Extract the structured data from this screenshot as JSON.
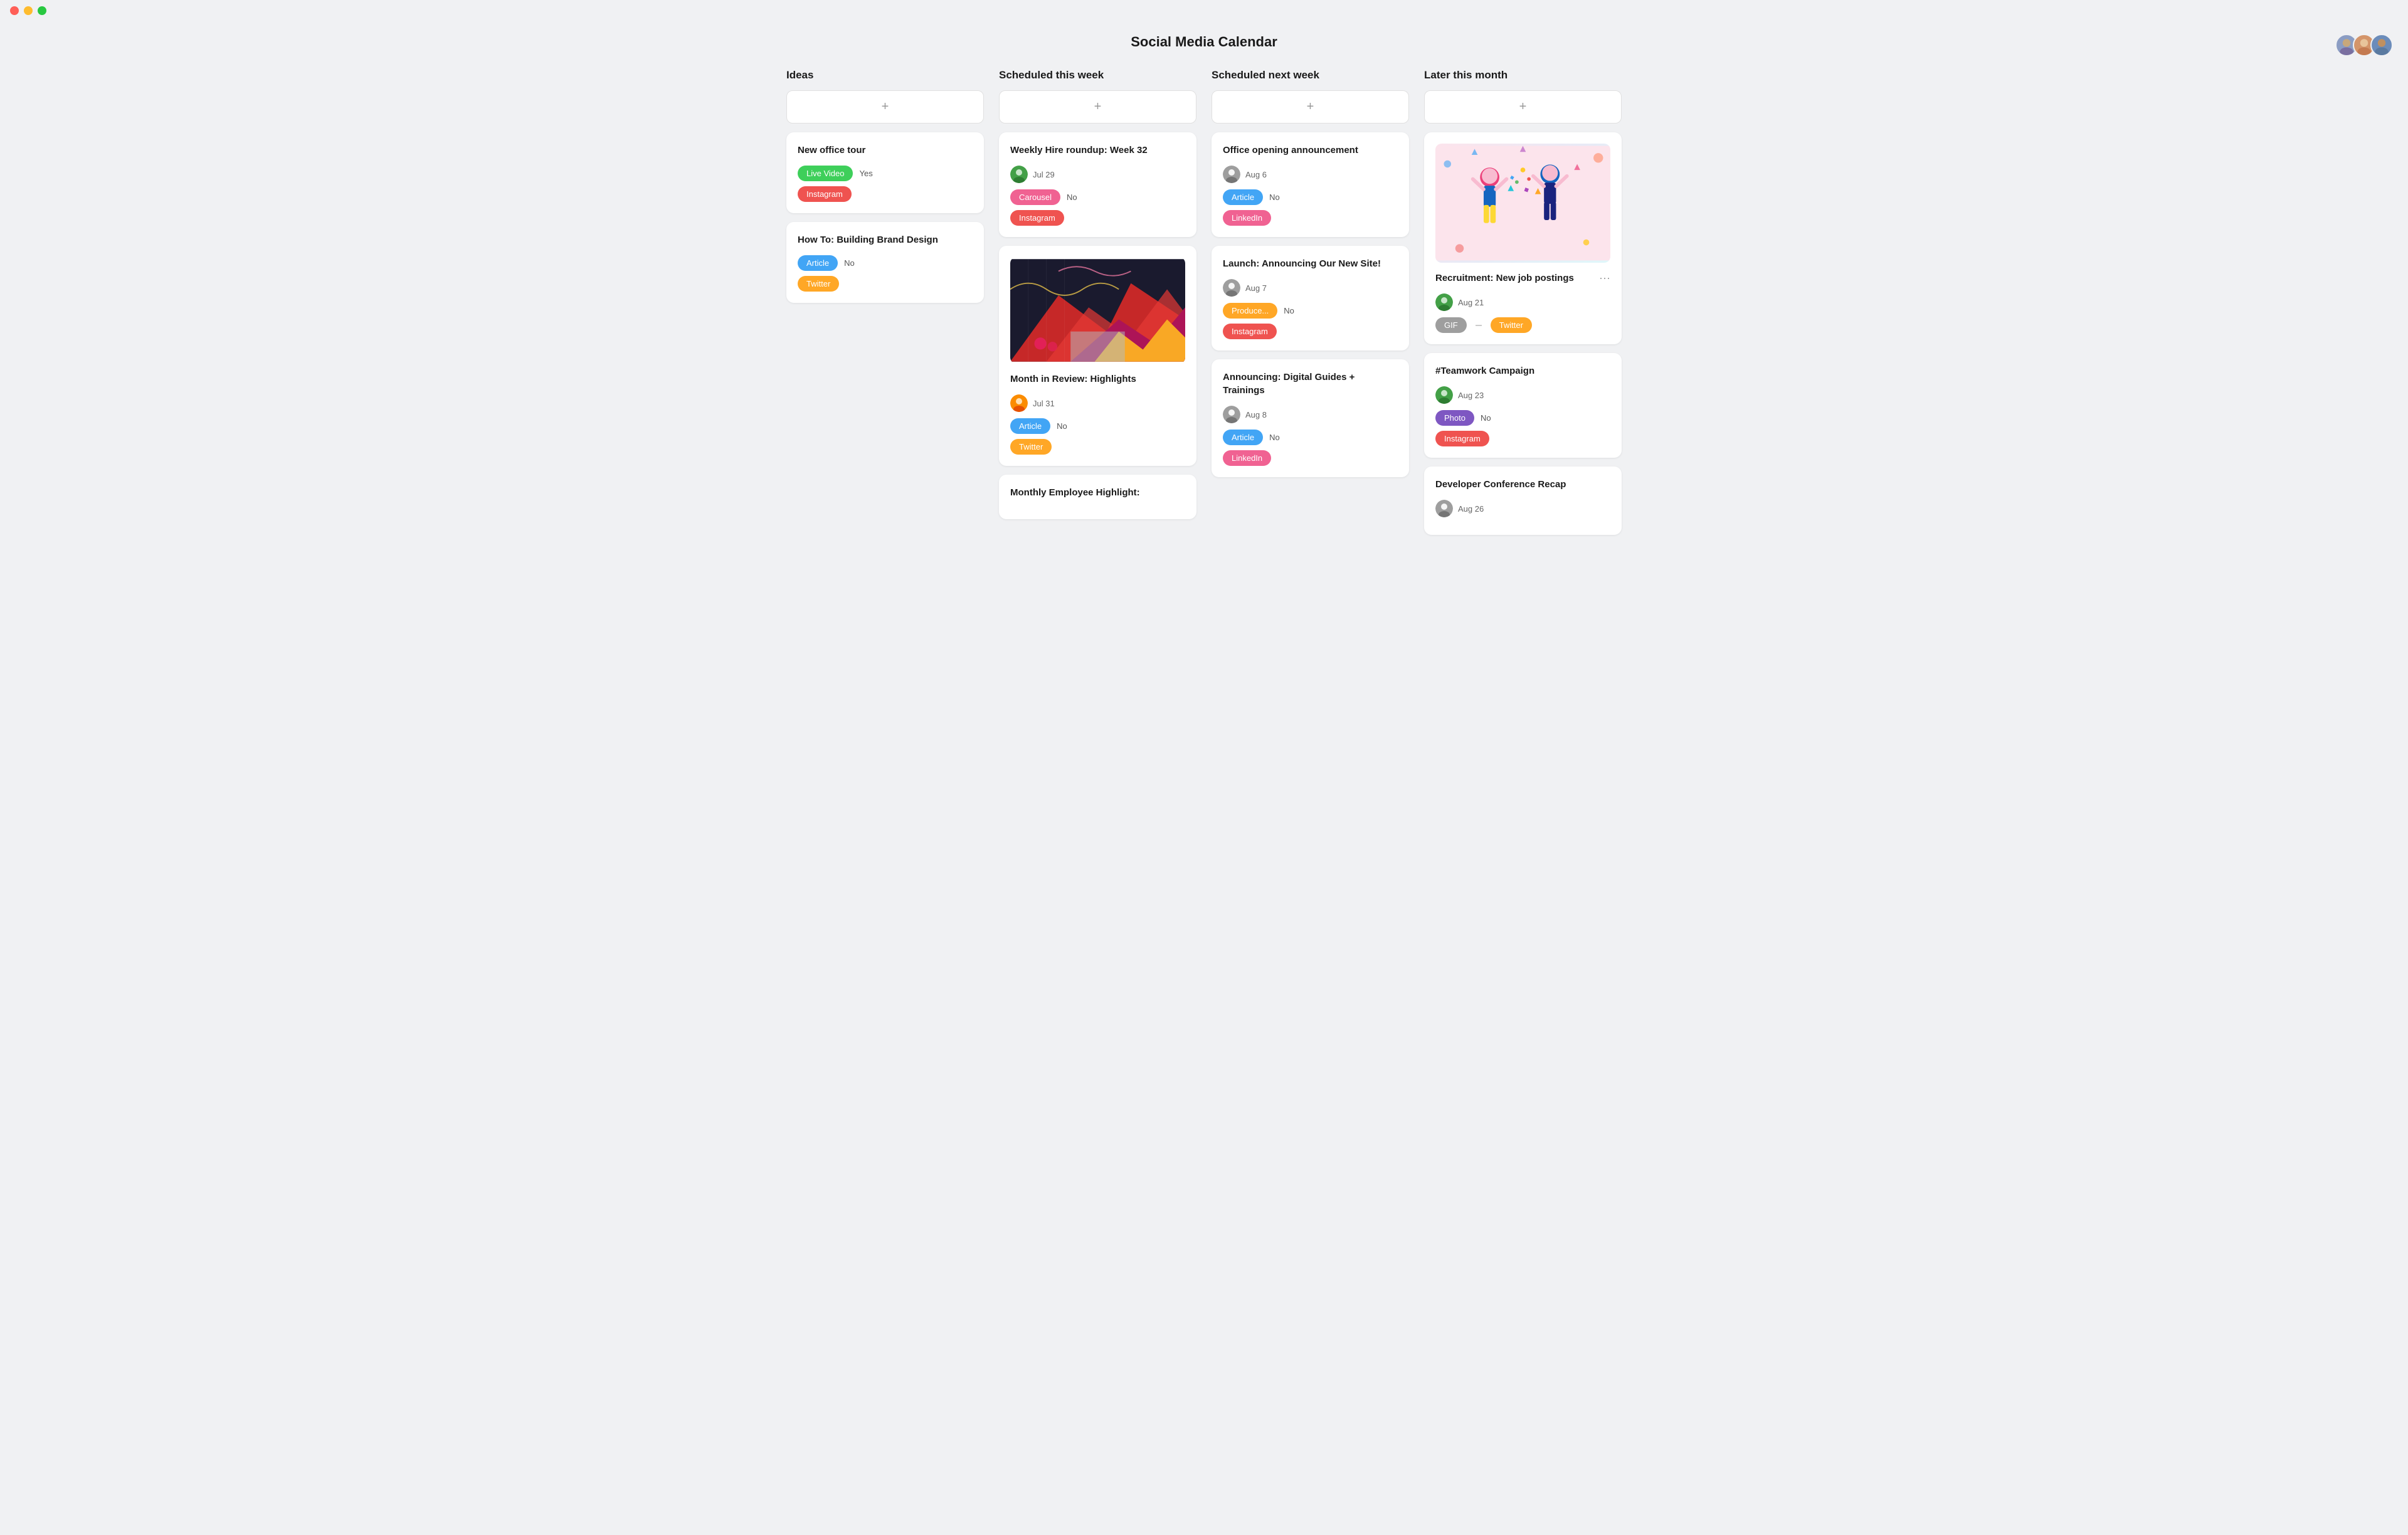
{
  "app": {
    "title": "Social Media Calendar"
  },
  "avatars": [
    {
      "id": "avatar-1",
      "color": "#8b9dc3",
      "emoji": "👩"
    },
    {
      "id": "avatar-2",
      "color": "#c4845a",
      "emoji": "👩"
    },
    {
      "id": "avatar-3",
      "color": "#6b8cba",
      "emoji": "👨"
    }
  ],
  "columns": [
    {
      "id": "ideas",
      "header": "Ideas",
      "add_label": "+",
      "cards": [
        {
          "id": "card-new-office",
          "title": "New office tour",
          "tags": [
            {
              "label": "Live Video",
              "color": "tag-green"
            },
            {
              "label": "Instagram",
              "color": "tag-red"
            }
          ],
          "value_label": "Yes",
          "show_value": true
        },
        {
          "id": "card-brand-design",
          "title": "How To: Building Brand Design",
          "tags": [
            {
              "label": "Article",
              "color": "tag-blue"
            },
            {
              "label": "Twitter",
              "color": "tag-orange"
            }
          ],
          "value_label": "No",
          "show_value": true
        }
      ]
    },
    {
      "id": "scheduled-this-week",
      "header": "Scheduled this week",
      "add_label": "+",
      "cards": [
        {
          "id": "card-weekly-hire",
          "title": "Weekly Hire roundup: Week 32",
          "date": "Jul 29",
          "avatar_color": "#43a047",
          "tags": [
            {
              "label": "Carousel",
              "color": "tag-pink"
            }
          ],
          "value_label": "No",
          "show_value": true,
          "platform_tag": {
            "label": "Instagram",
            "color": "tag-red"
          },
          "has_image": false
        },
        {
          "id": "card-month-review",
          "title": "Month in Review: Highlights",
          "date": "Jul 31",
          "avatar_color": "#fb8c00",
          "tags": [
            {
              "label": "Article",
              "color": "tag-blue"
            }
          ],
          "value_label": "No",
          "show_value": true,
          "platform_tag": {
            "label": "Twitter",
            "color": "tag-orange"
          },
          "has_image": true
        },
        {
          "id": "card-monthly-employee",
          "title": "Monthly Employee Highlight:",
          "date": "",
          "has_image": false,
          "truncated": true
        }
      ]
    },
    {
      "id": "scheduled-next-week",
      "header": "Scheduled next week",
      "add_label": "+",
      "cards": [
        {
          "id": "card-office-opening",
          "title": "Office opening announcement",
          "date": "Aug 6",
          "avatar_color": "#9e9e9e",
          "tags": [
            {
              "label": "Article",
              "color": "tag-blue"
            }
          ],
          "value_label": "No",
          "show_value": true,
          "platform_tag": {
            "label": "LinkedIn",
            "color": "tag-pink"
          }
        },
        {
          "id": "card-launch-site",
          "title": "Launch: Announcing Our New Site!",
          "date": "Aug 7",
          "avatar_color": "#9e9e9e",
          "tags": [
            {
              "label": "Produce...",
              "color": "tag-orange"
            }
          ],
          "value_label": "No",
          "show_value": true,
          "platform_tag": {
            "label": "Instagram",
            "color": "tag-red"
          }
        },
        {
          "id": "card-digital-guides",
          "title": "Announcing: Digital Guides + Trainings",
          "date": "Aug 8",
          "avatar_color": "#9e9e9e",
          "tags": [
            {
              "label": "Article",
              "color": "tag-blue"
            }
          ],
          "value_label": "No",
          "show_value": true,
          "platform_tag": {
            "label": "LinkedIn",
            "color": "tag-pink"
          },
          "has_image": true
        }
      ]
    },
    {
      "id": "later-this-month",
      "header": "Later this month",
      "add_label": "+",
      "cards": [
        {
          "id": "card-recruitment",
          "title": "Recruitment: New job postings",
          "date": "Aug 21",
          "avatar_color": "#43a047",
          "tags": [
            {
              "label": "GIF",
              "color": "tag-gray"
            },
            {
              "label": "Twitter",
              "color": "tag-orange"
            }
          ],
          "has_illustration": true,
          "show_menu": true
        },
        {
          "id": "card-teamwork",
          "title": "#Teamwork Campaign",
          "date": "Aug 23",
          "avatar_color": "#43a047",
          "tags": [
            {
              "label": "Photo",
              "color": "tag-purple"
            }
          ],
          "value_label": "No",
          "show_value": true,
          "platform_tag": {
            "label": "Instagram",
            "color": "tag-red"
          }
        },
        {
          "id": "card-dev-conference",
          "title": "Developer Conference Recap",
          "date": "Aug 26",
          "avatar_color": "#9e9e9e",
          "truncated": true
        }
      ]
    }
  ]
}
